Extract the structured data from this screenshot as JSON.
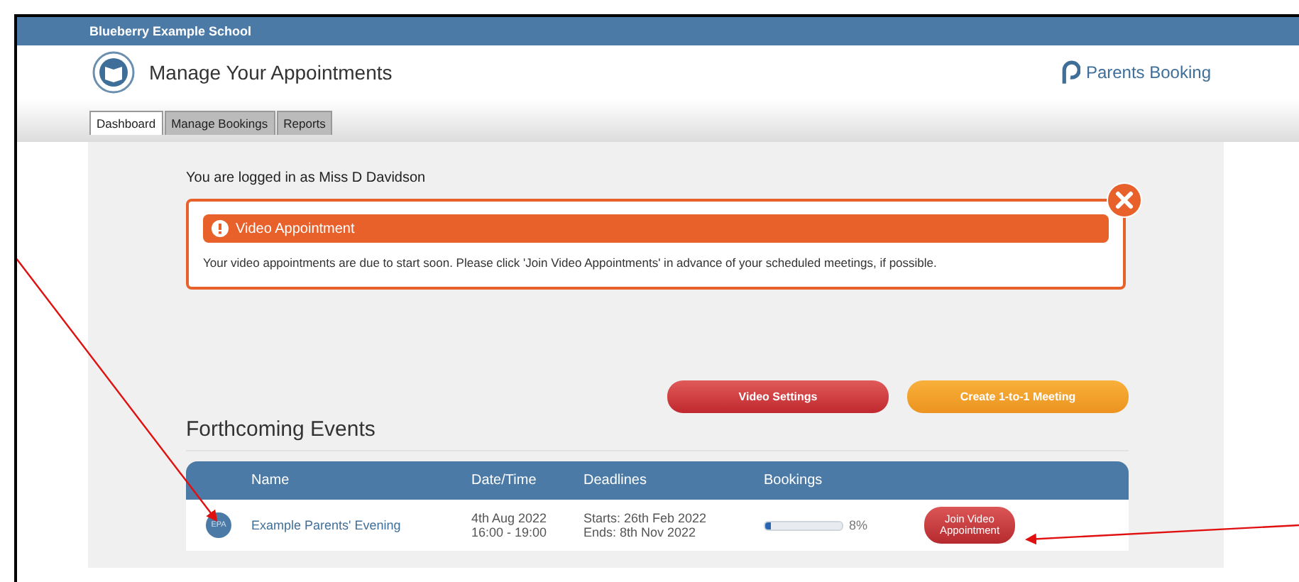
{
  "school": "Blueberry Example School",
  "header": {
    "title": "Manage Your Appointments",
    "brand": "Parents Booking"
  },
  "tabs": [
    {
      "label": "Dashboard",
      "selected": true
    },
    {
      "label": "Manage Bookings",
      "selected": false
    },
    {
      "label": "Reports",
      "selected": false
    }
  ],
  "logged_in": "You are logged in as Miss D Davidson",
  "alert": {
    "title": "Video Appointment",
    "message": "Your video appointments are due to start soon. Please click 'Join Video Appointments' in advance of your scheduled meetings, if possible."
  },
  "buttons": [
    {
      "label": "Video Settings",
      "kind": "danger"
    },
    {
      "label": "Create 1-to-1 Meeting",
      "kind": "warning"
    }
  ],
  "section_title": "Forthcoming Events",
  "table": {
    "columns": [
      "Name",
      "Date/Time",
      "Deadlines",
      "Bookings"
    ],
    "rows": [
      {
        "initials": "EPA",
        "name": "Example Parents' Evening",
        "date": "4th Aug 2022",
        "time": "16:00 - 19:00",
        "starts": "Starts: 26th Feb 2022",
        "ends": "Ends: 8th Nov 2022",
        "level": 0.08,
        "percent": "8%",
        "action": "Join Video Appointment"
      }
    ]
  }
}
